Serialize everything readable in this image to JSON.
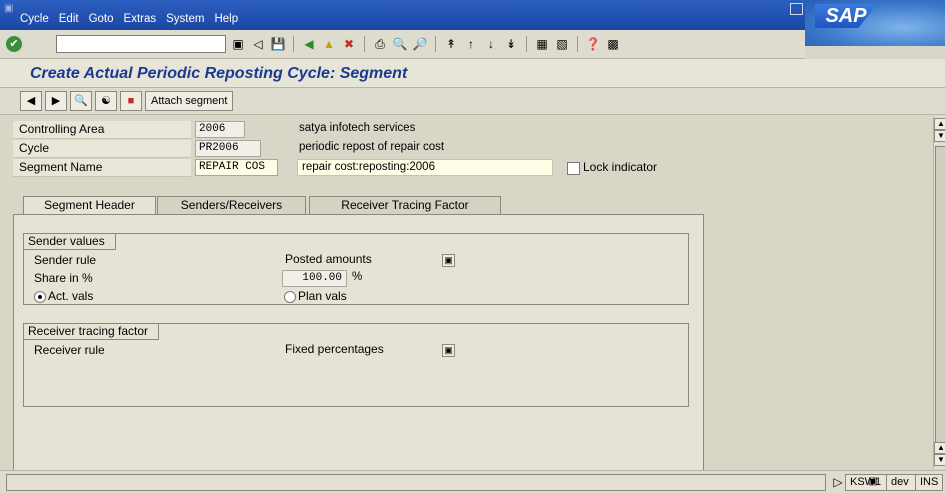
{
  "menu": {
    "items": [
      "Cycle",
      "Edit",
      "Goto",
      "Extras",
      "System",
      "Help"
    ]
  },
  "toolbar": {
    "command_value": ""
  },
  "title": "Create Actual Periodic Reposting Cycle: Segment",
  "app_toolbar": {
    "attach_label": "Attach segment"
  },
  "header": {
    "controlling_area": {
      "label": "Controlling Area",
      "value": "2006",
      "desc": "satya infotech  services"
    },
    "cycle": {
      "label": "Cycle",
      "value": "PR2006",
      "desc": "periodic repost of repair cost"
    },
    "segment": {
      "label": "Segment Name",
      "value": "REPAIR COS",
      "desc": "repair cost:reposting:2006"
    },
    "lock_label": "Lock indicator"
  },
  "tabs": [
    "Segment Header",
    "Senders/Receivers",
    "Receiver Tracing Factor"
  ],
  "sender_values": {
    "title": "Sender values",
    "sender_rule_label": "Sender rule",
    "sender_rule_value": "Posted amounts",
    "share_label": "Share in %",
    "share_value": "100.00",
    "share_unit": "%",
    "act_label": "Act. vals",
    "plan_label": "Plan vals"
  },
  "receiver": {
    "title": "Receiver tracing factor",
    "rule_label": "Receiver rule",
    "rule_value": "Fixed percentages"
  },
  "status": {
    "tcode": "KSW1",
    "system": "dev",
    "mode": "INS"
  },
  "colors": {
    "menubar": "#2b5fc0",
    "title": "#1a3a8f",
    "background": "#d9d6c8"
  }
}
